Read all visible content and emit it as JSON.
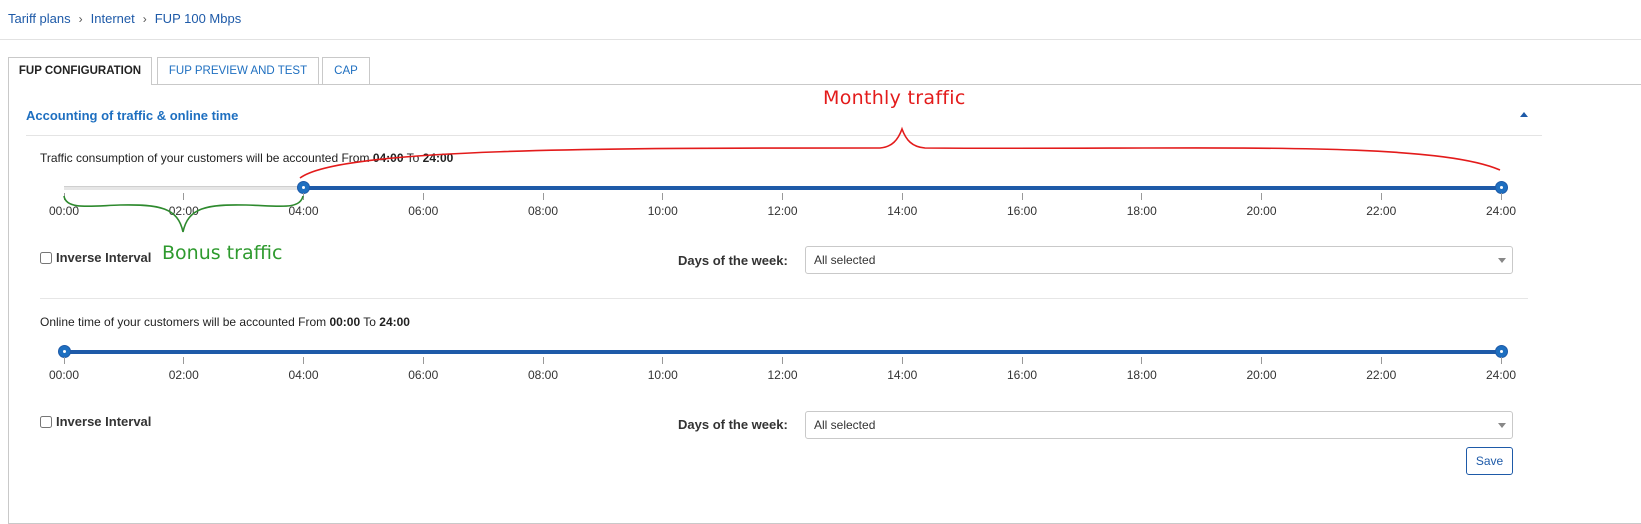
{
  "breadcrumb": {
    "items": [
      "Tariff plans",
      "Internet",
      "FUP 100 Mbps"
    ],
    "separator": "›"
  },
  "tabs": [
    {
      "label": "FUP CONFIGURATION",
      "active": true
    },
    {
      "label": "FUP PREVIEW AND TEST",
      "active": false
    },
    {
      "label": "CAP",
      "active": false
    }
  ],
  "section": {
    "title": "Accounting of traffic & online time",
    "collapse_icon": "caret-up-icon"
  },
  "traffic": {
    "desc_prefix": "Traffic consumption of your customers will be accounted From ",
    "from": "04:00",
    "desc_to": " To ",
    "to": "24:00",
    "range_start_hours": 4,
    "range_end_hours": 24,
    "inverse_label": "Inverse Interval",
    "inverse_checked": false,
    "days_label": "Days of the week:",
    "days_value": "All selected"
  },
  "online": {
    "desc_prefix": "Online time of your customers will be accounted From ",
    "from": "00:00",
    "desc_to": " To ",
    "to": "24:00",
    "range_start_hours": 0,
    "range_end_hours": 24,
    "inverse_label": "Inverse Interval",
    "inverse_checked": false,
    "days_label": "Days of the week:",
    "days_value": "All selected"
  },
  "ticks": [
    "00:00",
    "02:00",
    "04:00",
    "06:00",
    "08:00",
    "10:00",
    "12:00",
    "14:00",
    "16:00",
    "18:00",
    "20:00",
    "22:00",
    "24:00"
  ],
  "save_label": "Save",
  "annotations": {
    "monthly": "Monthly  traffic",
    "bonus": "Bonus traffic"
  },
  "colors": {
    "accent": "#1e5aa8",
    "monthly_annotation": "#e31b1b",
    "bonus_annotation": "#2e9a2e"
  }
}
